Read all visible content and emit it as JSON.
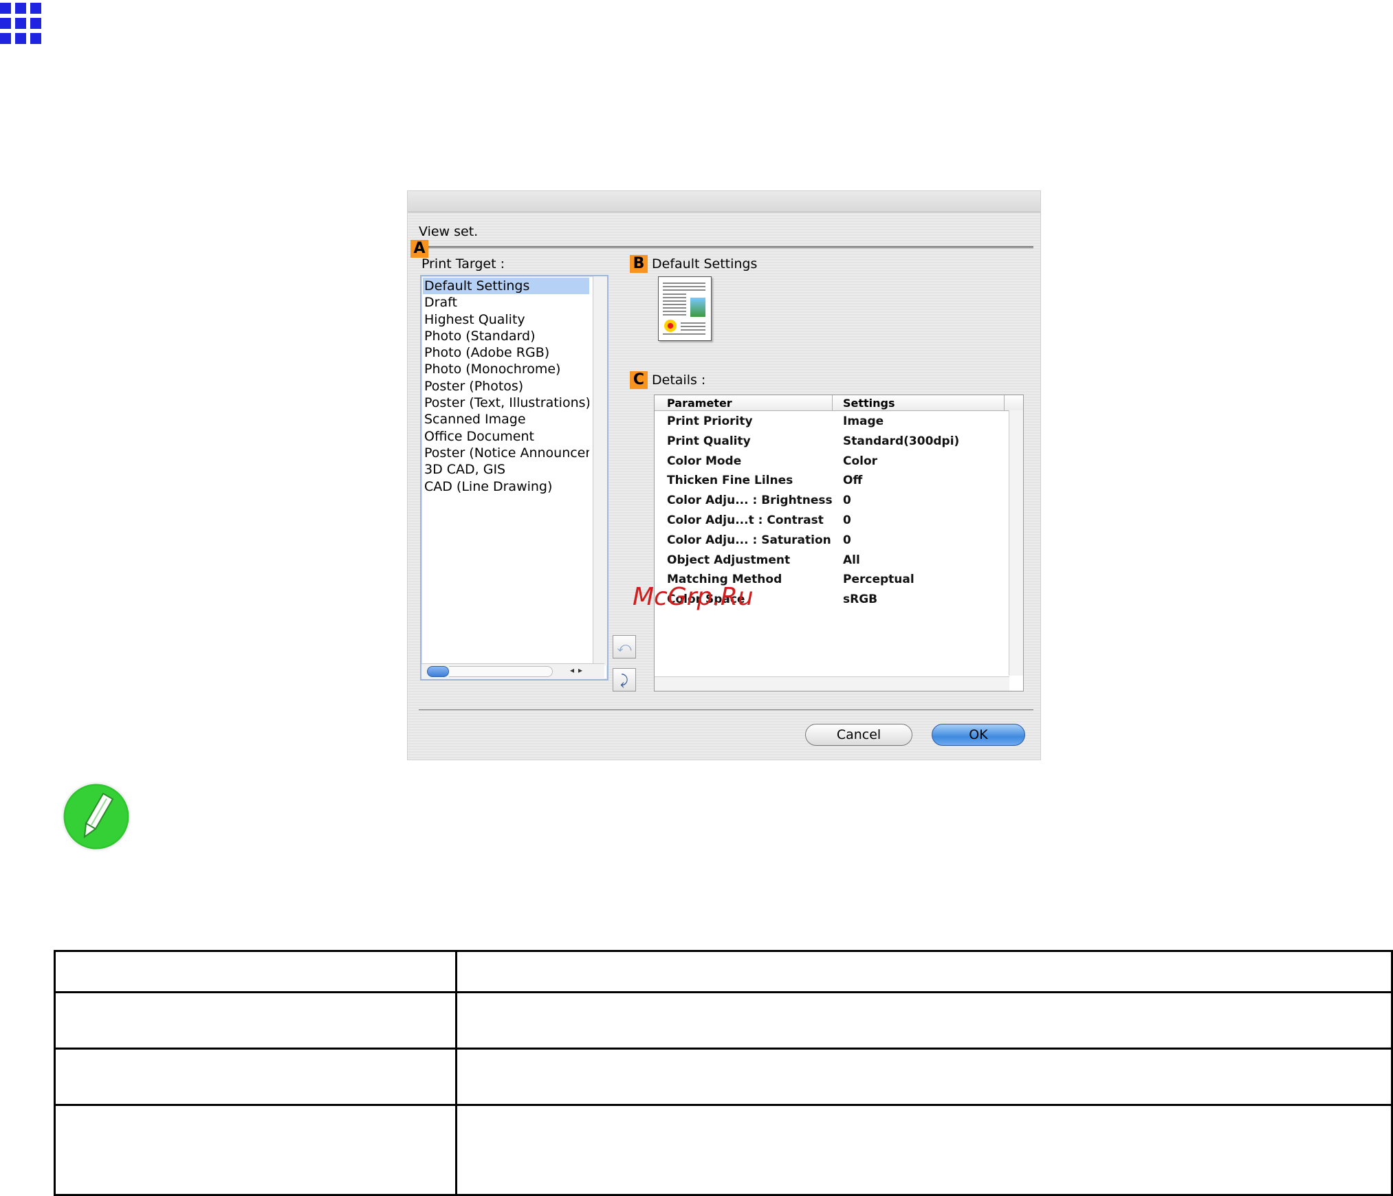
{
  "dialog": {
    "view_set_label": "View set.",
    "badges": {
      "a": "A",
      "b": "B",
      "c": "C"
    },
    "print_target": {
      "label": "Print Target :",
      "items": [
        "Default Settings",
        "Draft",
        "Highest Quality",
        "Photo (Standard)",
        "Photo (Adobe RGB)",
        "Photo (Monochrome)",
        "Poster (Photos)",
        "Poster (Text, Illustrations)",
        "Scanned Image",
        "Office Document",
        "Poster (Notice Announcer",
        "3D CAD, GIS",
        "CAD (Line Drawing)"
      ],
      "selected_index": 0
    },
    "default_settings_label": "Default Settings",
    "details": {
      "label": "Details :",
      "columns": [
        "Parameter",
        "Settings"
      ],
      "rows": [
        [
          "Print Priority",
          "Image"
        ],
        [
          "Print Quality",
          "Standard(300dpi)"
        ],
        [
          "Color Mode",
          "Color"
        ],
        [
          "Thicken Fine Lilnes",
          "Off"
        ],
        [
          "Color Adju... : Brightness",
          "0"
        ],
        [
          "Color Adju...t : Contrast",
          "0"
        ],
        [
          "Color Adju... : Saturation",
          "0"
        ],
        [
          "Object Adjustment",
          "All"
        ],
        [
          "Matching Method",
          "Perceptual"
        ],
        [
          "Color Space",
          "sRGB"
        ]
      ]
    },
    "buttons": {
      "cancel": "Cancel",
      "ok": "OK"
    }
  },
  "watermark": "McGrp.Ru",
  "icons": {
    "top_left": "grid-menu-icon",
    "note": "pencil-note-icon"
  },
  "colors": {
    "badge": "#f7931e",
    "grid_icon": "#1f24e0",
    "note_green": "#2ec52e",
    "selection": "#b5d1f6",
    "ok_button": "#3f8ae0"
  }
}
